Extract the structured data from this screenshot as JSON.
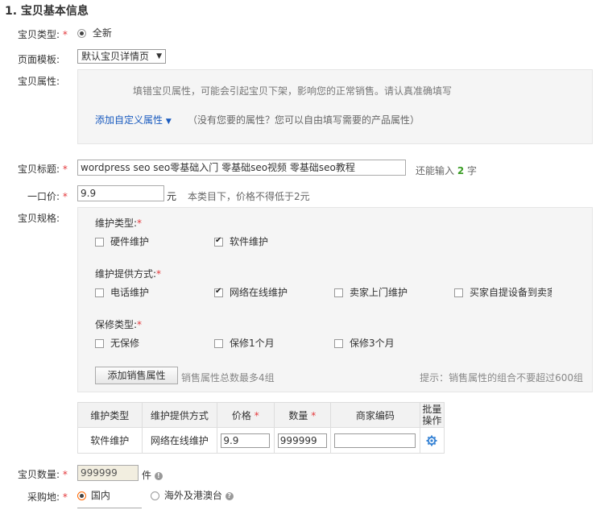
{
  "section_title": "1. 宝贝基本信息",
  "type": {
    "label": "宝贝类型:",
    "option": "全新"
  },
  "template": {
    "label": "页面模板:",
    "value": "默认宝贝详情页"
  },
  "attrs": {
    "label": "宝贝属性:",
    "notice": "填错宝贝属性，可能会引起宝贝下架，影响您的正常销售。请认真准确填写",
    "add_custom": "添加自定义属性",
    "add_custom_hint": "（没有您要的属性？您可以自由填写需要的产品属性）"
  },
  "title": {
    "label": "宝贝标题:",
    "value": "wordpress seo seo零基础入门 零基础seo视频 零基础seo教程",
    "remaining_prefix": "还能输入",
    "remaining_count": "2",
    "remaining_suffix": "字"
  },
  "price": {
    "label": "一口价:",
    "value": "9.9",
    "unit": "元",
    "hint": "本类目下，价格不得低于2元"
  },
  "spec": {
    "label": "宝贝规格:",
    "groups": [
      {
        "title": "维护类型:",
        "options": [
          {
            "label": "硬件维护",
            "checked": false
          },
          {
            "label": "软件维护",
            "checked": true
          }
        ]
      },
      {
        "title": "维护提供方式:",
        "options": [
          {
            "label": "电话维护",
            "checked": false
          },
          {
            "label": "网络在线维护",
            "checked": true
          },
          {
            "label": "卖家上门维护",
            "checked": false
          },
          {
            "label": "买家自提设备到卖家",
            "checked": false
          }
        ]
      },
      {
        "title": "保修类型:",
        "options": [
          {
            "label": "无保修",
            "checked": false
          },
          {
            "label": "保修1个月",
            "checked": false
          },
          {
            "label": "保修3个月",
            "checked": false
          }
        ]
      }
    ],
    "add_button": "添加销售属性",
    "add_hint": "销售属性总数最多4组",
    "tip": "提示：销售属性的组合不要超过600组"
  },
  "sku_table": {
    "headers": [
      "维护类型",
      "维护提供方式",
      "价格",
      "数量",
      "商家编码",
      "批量\n操作"
    ],
    "row": {
      "type": "软件维护",
      "method": "网络在线维护",
      "price": "9.9",
      "qty": "999999",
      "code": ""
    }
  },
  "quantity": {
    "label": "宝贝数量:",
    "value": "999999",
    "unit": "件"
  },
  "origin": {
    "label": "采购地:",
    "options": [
      "国内",
      "海外及港澳台"
    ]
  }
}
